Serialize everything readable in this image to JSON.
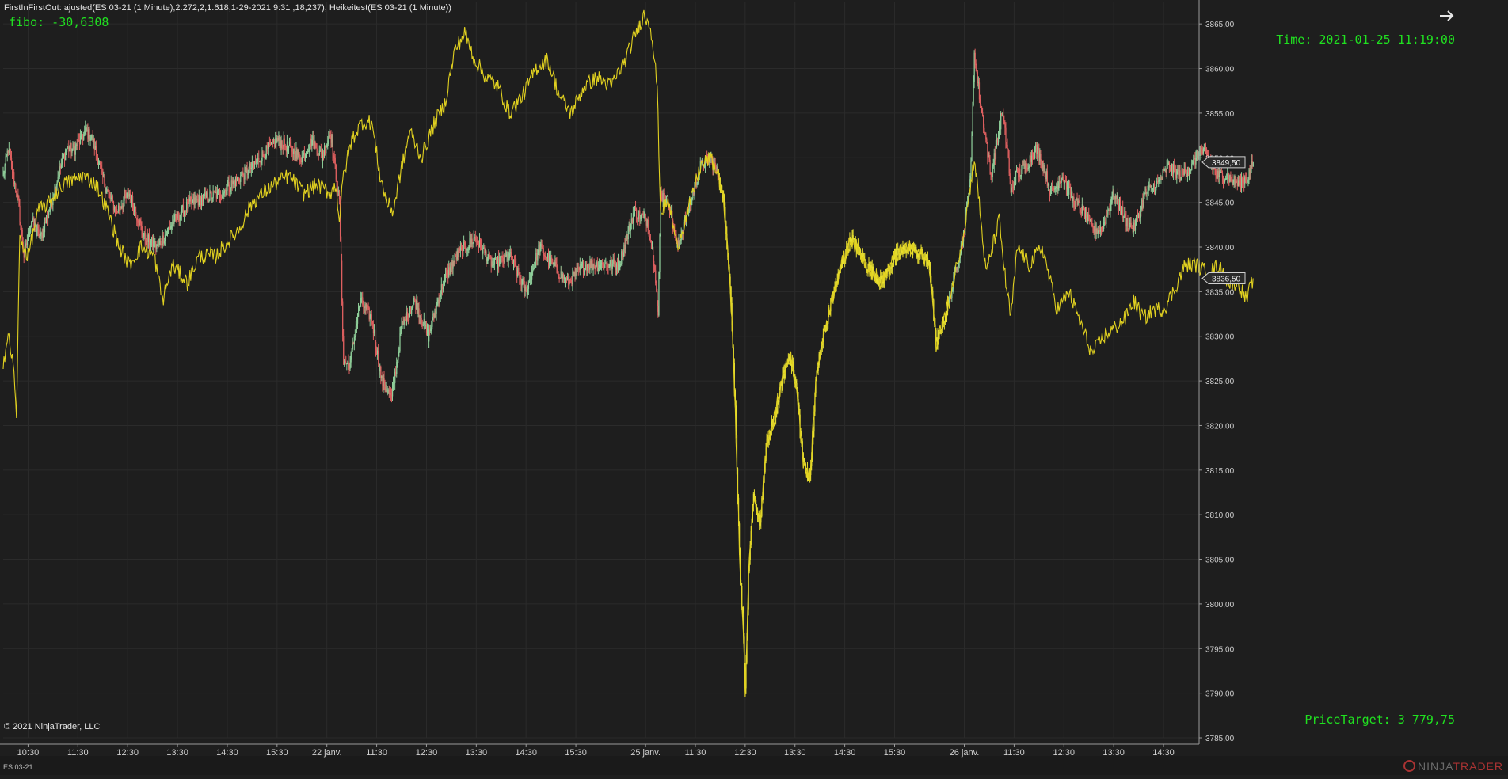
{
  "header": {
    "strategy_text": "FirstInFirstOut:  ajusted(ES 03-21 (1 Minute),2.272,2,1.618,1-29-2021 9:31 ,18,237), Heikeitest(ES 03-21 (1 Minute))"
  },
  "overlay": {
    "fibo": "fibo: -30,6308",
    "time": "Time: 2021-01-25 11:19:00",
    "price_target": "PriceTarget: 3 779,75"
  },
  "footer": {
    "copyright": "© 2021 NinjaTrader, LLC",
    "instrument": "ES 03-21",
    "brand_ninja": "NINJA",
    "brand_trader": "TRADER"
  },
  "icons": {
    "next": "arrow-right-icon",
    "brand": "ninjatrader-logo-icon"
  },
  "colors": {
    "background": "#1e1e1e",
    "grid": "#2b2b2b",
    "candle_up": "#8fcf9a",
    "candle_down": "#e06060",
    "candle_highlight": "#e8e030",
    "line": "#e0d020",
    "text_accent": "#20e020",
    "axis_text": "#d0d0d0"
  },
  "chart_data": {
    "type": "line",
    "instrument": "ES 03-21 (1 Minute)",
    "ylim": [
      3785,
      3867.5
    ],
    "y_ticks": [
      "3865,00",
      "3860,00",
      "3855,00",
      "3850,00",
      "3845,00",
      "3840,00",
      "3835,00",
      "3830,00",
      "3825,00",
      "3820,00",
      "3815,00",
      "3810,00",
      "3805,00",
      "3800,00",
      "3795,00",
      "3790,00",
      "3785,00"
    ],
    "y_tick_values": [
      3865,
      3860,
      3855,
      3850,
      3845,
      3840,
      3835,
      3830,
      3825,
      3820,
      3815,
      3810,
      3805,
      3800,
      3795,
      3790,
      3785
    ],
    "x_ticks": [
      "10:30",
      "11:30",
      "12:30",
      "13:30",
      "14:30",
      "15:30",
      "22 janv.",
      "11:30",
      "12:30",
      "13:30",
      "14:30",
      "15:30",
      "25 janv.",
      "11:30",
      "12:30",
      "13:30",
      "14:30",
      "15:30",
      "26 janv.",
      "11:30",
      "12:30",
      "13:30",
      "14:30"
    ],
    "x_tick_index": [
      30,
      90,
      150,
      210,
      270,
      330,
      390,
      450,
      510,
      570,
      630,
      690,
      774,
      834,
      894,
      954,
      1014,
      1074,
      1158,
      1218,
      1278,
      1338,
      1398
    ],
    "x_count": 1440,
    "current_prices": [
      {
        "label": "3849,50",
        "value": 3849.5
      },
      {
        "label": "3836,50",
        "value": 3836.5
      }
    ],
    "series": [
      {
        "type": "candlestick",
        "anchors": [
          [
            0,
            3848
          ],
          [
            6,
            3851
          ],
          [
            18,
            3845
          ],
          [
            25,
            3839
          ],
          [
            34,
            3843
          ],
          [
            45,
            3841
          ],
          [
            58,
            3845
          ],
          [
            66,
            3848
          ],
          [
            76,
            3851
          ],
          [
            86,
            3851
          ],
          [
            100,
            3853
          ],
          [
            108,
            3852
          ],
          [
            122,
            3847
          ],
          [
            136,
            3844
          ],
          [
            152,
            3846
          ],
          [
            170,
            3841
          ],
          [
            186,
            3840
          ],
          [
            206,
            3843
          ],
          [
            226,
            3845
          ],
          [
            262,
            3846
          ],
          [
            300,
            3849
          ],
          [
            330,
            3852
          ],
          [
            346,
            3851
          ],
          [
            360,
            3850
          ],
          [
            372,
            3852
          ],
          [
            384,
            3850
          ],
          [
            394,
            3853
          ],
          [
            401,
            3848
          ],
          [
            405,
            3845
          ],
          [
            410,
            3827
          ],
          [
            418,
            3827
          ],
          [
            430,
            3834
          ],
          [
            444,
            3832
          ],
          [
            456,
            3825
          ],
          [
            468,
            3823
          ],
          [
            480,
            3831
          ],
          [
            496,
            3834
          ],
          [
            512,
            3830
          ],
          [
            530,
            3836
          ],
          [
            546,
            3839
          ],
          [
            568,
            3841
          ],
          [
            590,
            3838
          ],
          [
            610,
            3839
          ],
          [
            630,
            3835
          ],
          [
            646,
            3840
          ],
          [
            662,
            3838
          ],
          [
            680,
            3836
          ],
          [
            700,
            3838
          ],
          [
            720,
            3838
          ],
          [
            742,
            3838
          ],
          [
            760,
            3844
          ],
          [
            776,
            3843
          ],
          [
            785,
            3838
          ],
          [
            789,
            3832
          ],
          [
            792,
            3846
          ],
          [
            802,
            3845
          ],
          [
            812,
            3840
          ],
          [
            828,
            3845
          ],
          [
            840,
            3849
          ],
          [
            852,
            3850
          ],
          [
            862,
            3848
          ],
          [
            868,
            3845
          ],
          [
            876,
            3836
          ],
          [
            882,
            3822
          ],
          [
            888,
            3803
          ],
          [
            892,
            3797
          ],
          [
            894,
            3790
          ],
          [
            898,
            3803
          ],
          [
            904,
            3812
          ],
          [
            912,
            3809
          ],
          [
            920,
            3818
          ],
          [
            930,
            3821
          ],
          [
            938,
            3825
          ],
          [
            948,
            3828
          ],
          [
            956,
            3824
          ],
          [
            964,
            3816
          ],
          [
            972,
            3814
          ],
          [
            980,
            3826
          ],
          [
            988,
            3830
          ],
          [
            998,
            3834
          ],
          [
            1010,
            3838
          ],
          [
            1022,
            3841
          ],
          [
            1040,
            3838
          ],
          [
            1058,
            3836
          ],
          [
            1075,
            3839
          ],
          [
            1090,
            3840
          ],
          [
            1108,
            3839
          ],
          [
            1116,
            3838
          ],
          [
            1124,
            3829
          ],
          [
            1140,
            3834
          ],
          [
            1158,
            3842
          ],
          [
            1166,
            3849
          ],
          [
            1170,
            3862
          ],
          [
            1176,
            3857
          ],
          [
            1184,
            3852
          ],
          [
            1190,
            3848
          ],
          [
            1198,
            3852
          ],
          [
            1203,
            3855
          ],
          [
            1210,
            3851
          ],
          [
            1214,
            3846
          ],
          [
            1220,
            3848
          ],
          [
            1232,
            3849
          ],
          [
            1244,
            3851
          ],
          [
            1254,
            3849
          ],
          [
            1262,
            3846
          ],
          [
            1276,
            3848
          ],
          [
            1290,
            3845
          ],
          [
            1302,
            3844
          ],
          [
            1312,
            3842
          ],
          [
            1324,
            3842
          ],
          [
            1338,
            3846
          ],
          [
            1352,
            3843
          ],
          [
            1362,
            3842
          ],
          [
            1376,
            3846
          ],
          [
            1390,
            3847
          ],
          [
            1404,
            3849
          ],
          [
            1418,
            3848
          ],
          [
            1432,
            3849
          ],
          [
            1442,
            3851
          ],
          [
            1452,
            3850
          ],
          [
            1462,
            3848
          ],
          [
            1474,
            3848
          ],
          [
            1488,
            3847
          ],
          [
            1500,
            3848
          ],
          [
            1506,
            3849.5
          ]
        ]
      },
      {
        "type": "line",
        "anchors": [
          [
            0,
            3827
          ],
          [
            6,
            3830
          ],
          [
            12,
            3827
          ],
          [
            16,
            3821
          ],
          [
            20,
            3841
          ],
          [
            30,
            3839
          ],
          [
            42,
            3844
          ],
          [
            56,
            3845
          ],
          [
            72,
            3847
          ],
          [
            96,
            3848
          ],
          [
            112,
            3847
          ],
          [
            126,
            3844
          ],
          [
            140,
            3840
          ],
          [
            152,
            3838
          ],
          [
            166,
            3840
          ],
          [
            182,
            3839
          ],
          [
            192,
            3834
          ],
          [
            204,
            3838
          ],
          [
            222,
            3836
          ],
          [
            236,
            3839
          ],
          [
            256,
            3839
          ],
          [
            284,
            3842
          ],
          [
            300,
            3845
          ],
          [
            326,
            3847
          ],
          [
            344,
            3848
          ],
          [
            362,
            3846
          ],
          [
            378,
            3847
          ],
          [
            394,
            3846
          ],
          [
            401,
            3847
          ],
          [
            405,
            3843
          ],
          [
            410,
            3848
          ],
          [
            420,
            3852
          ],
          [
            432,
            3854
          ],
          [
            444,
            3854
          ],
          [
            454,
            3848
          ],
          [
            462,
            3845
          ],
          [
            470,
            3844
          ],
          [
            478,
            3848
          ],
          [
            490,
            3853
          ],
          [
            504,
            3850
          ],
          [
            520,
            3854
          ],
          [
            532,
            3856
          ],
          [
            544,
            3862
          ],
          [
            556,
            3864
          ],
          [
            568,
            3861
          ],
          [
            582,
            3859
          ],
          [
            596,
            3858
          ],
          [
            610,
            3855
          ],
          [
            626,
            3857
          ],
          [
            642,
            3860
          ],
          [
            656,
            3861
          ],
          [
            670,
            3857
          ],
          [
            684,
            3855
          ],
          [
            700,
            3858
          ],
          [
            716,
            3859
          ],
          [
            732,
            3858
          ],
          [
            750,
            3861
          ],
          [
            762,
            3864
          ],
          [
            772,
            3866
          ],
          [
            780,
            3865
          ],
          [
            788,
            3858
          ],
          [
            792,
            3844
          ],
          [
            802,
            3845
          ],
          [
            812,
            3840
          ],
          [
            828,
            3845
          ],
          [
            840,
            3849
          ],
          [
            852,
            3850
          ],
          [
            862,
            3848
          ],
          [
            868,
            3845
          ],
          [
            876,
            3836
          ],
          [
            882,
            3822
          ],
          [
            888,
            3803
          ],
          [
            892,
            3797
          ],
          [
            894,
            3790
          ],
          [
            898,
            3803
          ],
          [
            904,
            3812
          ],
          [
            912,
            3809
          ],
          [
            920,
            3818
          ],
          [
            930,
            3821
          ],
          [
            938,
            3825
          ],
          [
            948,
            3828
          ],
          [
            956,
            3824
          ],
          [
            964,
            3816
          ],
          [
            972,
            3814
          ],
          [
            980,
            3826
          ],
          [
            988,
            3830
          ],
          [
            998,
            3834
          ],
          [
            1010,
            3838
          ],
          [
            1022,
            3841
          ],
          [
            1040,
            3838
          ],
          [
            1058,
            3836
          ],
          [
            1075,
            3839
          ],
          [
            1090,
            3840
          ],
          [
            1108,
            3839
          ],
          [
            1116,
            3838
          ],
          [
            1124,
            3829
          ],
          [
            1140,
            3834
          ],
          [
            1158,
            3842
          ],
          [
            1170,
            3850
          ],
          [
            1176,
            3845
          ],
          [
            1184,
            3837
          ],
          [
            1192,
            3840
          ],
          [
            1200,
            3843
          ],
          [
            1208,
            3836
          ],
          [
            1214,
            3832
          ],
          [
            1222,
            3840
          ],
          [
            1236,
            3838
          ],
          [
            1252,
            3840
          ],
          [
            1262,
            3836
          ],
          [
            1270,
            3833
          ],
          [
            1284,
            3835
          ],
          [
            1296,
            3832
          ],
          [
            1312,
            3828
          ],
          [
            1326,
            3830
          ],
          [
            1340,
            3831
          ],
          [
            1352,
            3832
          ],
          [
            1362,
            3834
          ],
          [
            1374,
            3832
          ],
          [
            1386,
            3833
          ],
          [
            1398,
            3833
          ],
          [
            1410,
            3835
          ],
          [
            1424,
            3838
          ],
          [
            1438,
            3838
          ],
          [
            1452,
            3837
          ],
          [
            1464,
            3838
          ],
          [
            1476,
            3836
          ],
          [
            1488,
            3836
          ],
          [
            1498,
            3834
          ],
          [
            1506,
            3836.5
          ]
        ]
      }
    ]
  }
}
